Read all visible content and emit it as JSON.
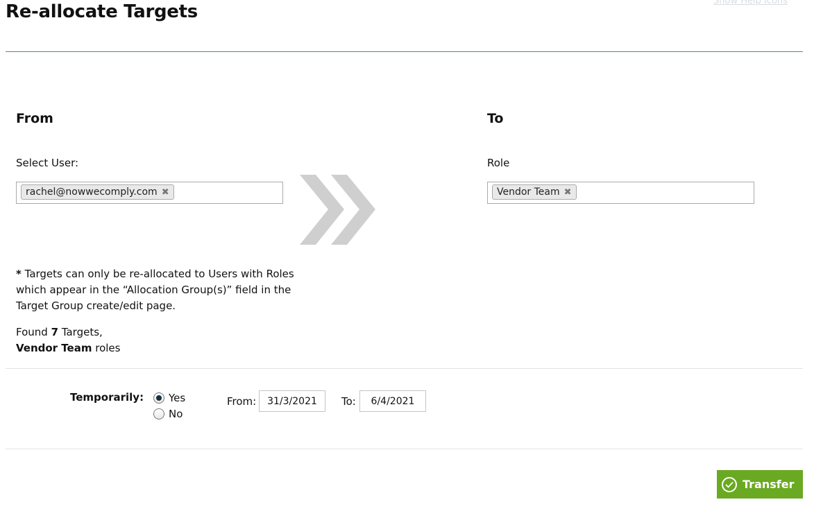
{
  "header": {
    "title": "Re-allocate Targets",
    "help_link": "Show Help Icons"
  },
  "from": {
    "heading": "From",
    "field_label": "Select User:",
    "tags": [
      "rachel@nowwecomply.com"
    ]
  },
  "to": {
    "heading": "To",
    "field_label": "Role",
    "tags": [
      "Vendor Team"
    ]
  },
  "transfer_arrow_icon": "double-chevron-right-icon",
  "note": {
    "asterisk": "*",
    "text": "Targets can only be re-allocated to Users with Roles which appear in the “Allocation Group(s)” field in the Target Group create/edit page."
  },
  "found": {
    "prefix": "Found",
    "count": "7",
    "suffix": "Targets,",
    "role": "Vendor Team",
    "role_suffix": "roles"
  },
  "temporarily": {
    "label": "Temporarily:",
    "options": [
      {
        "label": "Yes",
        "selected": true
      },
      {
        "label": "No",
        "selected": false
      }
    ],
    "from_label": "From:",
    "from_value": "31/3/2021",
    "to_label": "To:",
    "to_value": "6/4/2021"
  },
  "actions": {
    "transfer_label": "Transfer",
    "transfer_icon": "check-circle-icon"
  },
  "colors": {
    "accent_green": "#6aa922",
    "title_rule": "#4b8a92",
    "arrow_gray": "#cfcfcf"
  }
}
